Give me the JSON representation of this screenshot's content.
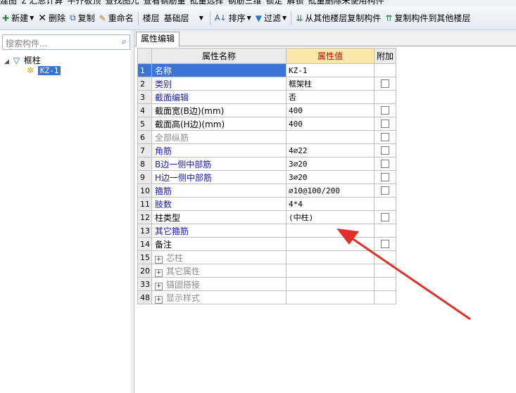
{
  "top_clipped": [
    "建图",
    "Σ 汇总计算",
    "平齐板顶",
    "查找图元",
    "查看钢筋量",
    "批量选择",
    "钢筋三维",
    "锁定",
    "解锁",
    "批量删除未使用构件"
  ],
  "toolbar": {
    "new_label": "新建",
    "delete_label": "删除",
    "copy_label": "复制",
    "rename_label": "重命名",
    "floor_label": "楼层",
    "floor_value": "基础层",
    "sort_label": "排序",
    "filter_label": "过滤",
    "copy_from_label": "从其他楼层复制构件",
    "copy_to_label": "复制构件到其他楼层"
  },
  "left_panel": {
    "search_placeholder": "搜索构件...",
    "tree_root": "框柱",
    "tree_child": "KZ-1"
  },
  "tab": {
    "label": "属性编辑"
  },
  "grid": {
    "headers": [
      "属性名称",
      "属性值",
      "附加"
    ],
    "rows": [
      {
        "num": "1",
        "name": "名称",
        "value": "KZ-1",
        "check": false,
        "color": "blue"
      },
      {
        "num": "2",
        "name": "类别",
        "value": "框架柱",
        "check": true,
        "color": "blue"
      },
      {
        "num": "3",
        "name": "截面编辑",
        "value": "否",
        "check": false,
        "color": "blue"
      },
      {
        "num": "4",
        "name": "截面宽(B边)(mm)",
        "value": "400",
        "check": true,
        "color": "black"
      },
      {
        "num": "5",
        "name": "截面高(H边)(mm)",
        "value": "400",
        "check": true,
        "color": "black"
      },
      {
        "num": "6",
        "name": "全部纵筋",
        "value": "",
        "check": true,
        "color": "gray"
      },
      {
        "num": "7",
        "name": "角筋",
        "value": "4⌀22",
        "check": true,
        "color": "blue"
      },
      {
        "num": "8",
        "name": "B边一侧中部筋",
        "value": "3⌀20",
        "check": true,
        "color": "blue"
      },
      {
        "num": "9",
        "name": "H边一侧中部筋",
        "value": "3⌀20",
        "check": true,
        "color": "blue"
      },
      {
        "num": "10",
        "name": "箍筋",
        "value": "⌀10@100/200",
        "check": true,
        "color": "blue"
      },
      {
        "num": "11",
        "name": "肢数",
        "value": "4*4",
        "check": false,
        "color": "blue"
      },
      {
        "num": "12",
        "name": "柱类型",
        "value": "(中柱)",
        "check": true,
        "color": "black"
      },
      {
        "num": "13",
        "name": "其它箍筋",
        "value": "",
        "check": false,
        "color": "blue"
      },
      {
        "num": "14",
        "name": "备注",
        "value": "",
        "check": true,
        "color": "black"
      },
      {
        "num": "15",
        "name": "芯柱",
        "value": "",
        "check": false,
        "color": "gray",
        "group": true
      },
      {
        "num": "20",
        "name": "其它属性",
        "value": "",
        "check": false,
        "color": "gray",
        "group": true
      },
      {
        "num": "33",
        "name": "锚固搭接",
        "value": "",
        "check": false,
        "color": "gray",
        "group": true
      },
      {
        "num": "48",
        "name": "显示样式",
        "value": "",
        "check": false,
        "color": "gray",
        "group": true
      }
    ]
  },
  "colors": {
    "selection": "#3875d7",
    "header_value_bg": "#fbe7a9",
    "header_value_text": "#c00000",
    "annotation_arrow": "#e0302a"
  }
}
